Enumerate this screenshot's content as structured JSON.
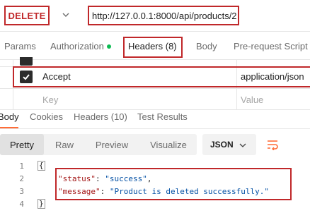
{
  "request": {
    "method": "DELETE",
    "url": "http://127.0.0.1:8000/api/products/2"
  },
  "request_tabs": {
    "params": "Params",
    "authorization": "Authorization",
    "headers": "Headers (8)",
    "body": "Body",
    "pre_request_script": "Pre-request Script"
  },
  "headers_table": {
    "row": {
      "key": "Accept",
      "value": "application/json",
      "checked": true
    },
    "placeholder_key": "Key",
    "placeholder_value": "Value"
  },
  "response_tabs": {
    "body": "Body",
    "cookies": "Cookies",
    "headers": "Headers (10)",
    "test_results": "Test Results"
  },
  "view_modes": {
    "pretty": "Pretty",
    "raw": "Raw",
    "preview": "Preview",
    "visualize": "Visualize",
    "format": "JSON"
  },
  "response_body": {
    "line_numbers": [
      "1",
      "2",
      "3",
      "4"
    ],
    "open_brace": "{",
    "close_brace": "}",
    "line2": {
      "key": "\"status\"",
      "sep": ": ",
      "value": "\"success\"",
      "end": ","
    },
    "line3": {
      "key": "\"message\"",
      "sep": ": ",
      "value": "\"Product is deleted successfully.\"",
      "end": ""
    }
  },
  "colors": {
    "accent_red": "#c0282a",
    "active_tab_orange": "#ff6c37",
    "auth_dot_green": "#0cbb52",
    "json_key": "#a31515",
    "json_string": "#0451a5"
  }
}
